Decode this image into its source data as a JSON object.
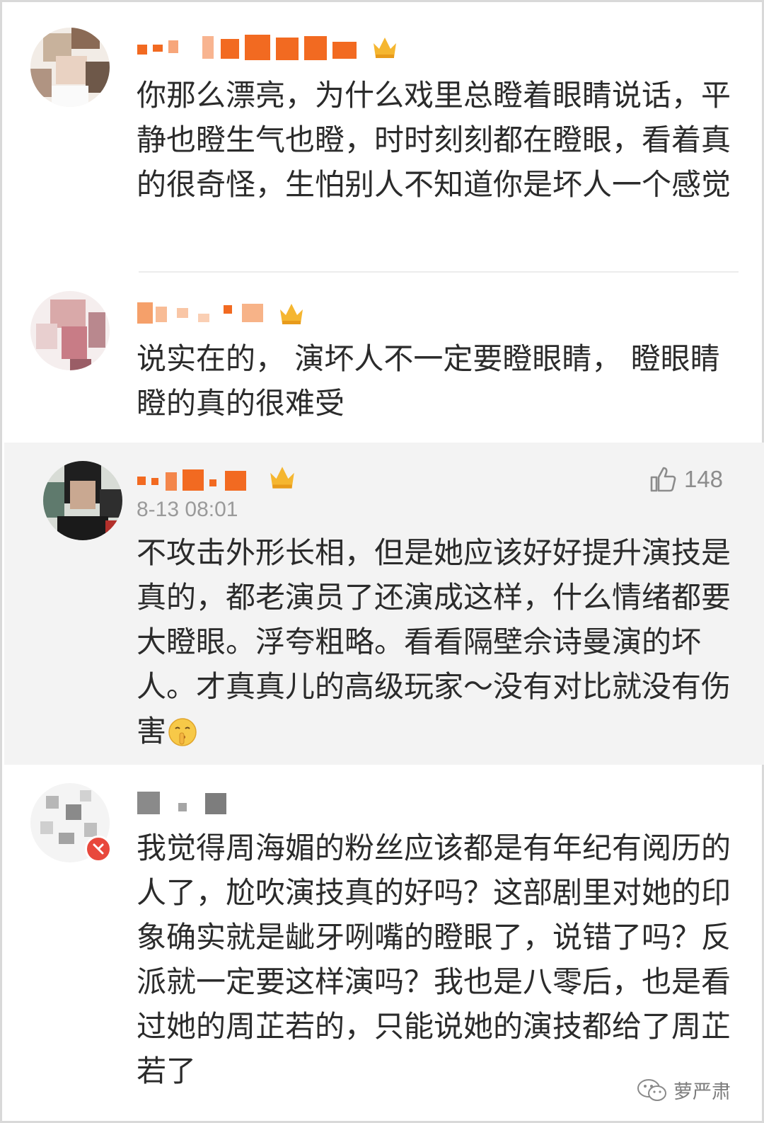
{
  "comments": [
    {
      "text": "你那么漂亮，为什么戏里总瞪着眼睛说话，平静也瞪生气也瞪，时时刻刻都在瞪眼，看着真的很奇怪，生怕别人不知道你是坏人一个感觉"
    },
    {
      "text": "说实在的， 演坏人不一定要瞪眼睛， 瞪眼睛瞪的真的很难受"
    },
    {
      "timestamp": "8-13 08:01",
      "likes": "148",
      "text": "不攻击外形长相，但是她应该好好提升演技是真的，都老演员了还演成这样，什么情绪都要大瞪眼。浮夸粗略。看看隔壁佘诗曼演的坏人。才真真儿的高级玩家～没有对比就没有伤害"
    },
    {
      "text": "我觉得周海媚的粉丝应该都是有年纪有阅历的人了，尬吹演技真的好吗？这部剧里对她的印象确实就是龇牙咧嘴的瞪眼了，说错了吗？反派就一定要这样演吗？我也是八零后，也是看过她的周芷若的，只能说她的演技都给了周芷若了"
    }
  ],
  "watermark": {
    "label": "萝严肃"
  },
  "colors": {
    "username_orange": "#f26a21",
    "badge_gold": "#f5b630",
    "highlight_bg": "#f3f3f3",
    "divider": "#ececec"
  },
  "icons": {
    "like": "thumbs-up-icon",
    "emoji": "shush-emoji-icon",
    "vip_badge": "crown-badge-icon",
    "watermark": "wechat-icon"
  }
}
